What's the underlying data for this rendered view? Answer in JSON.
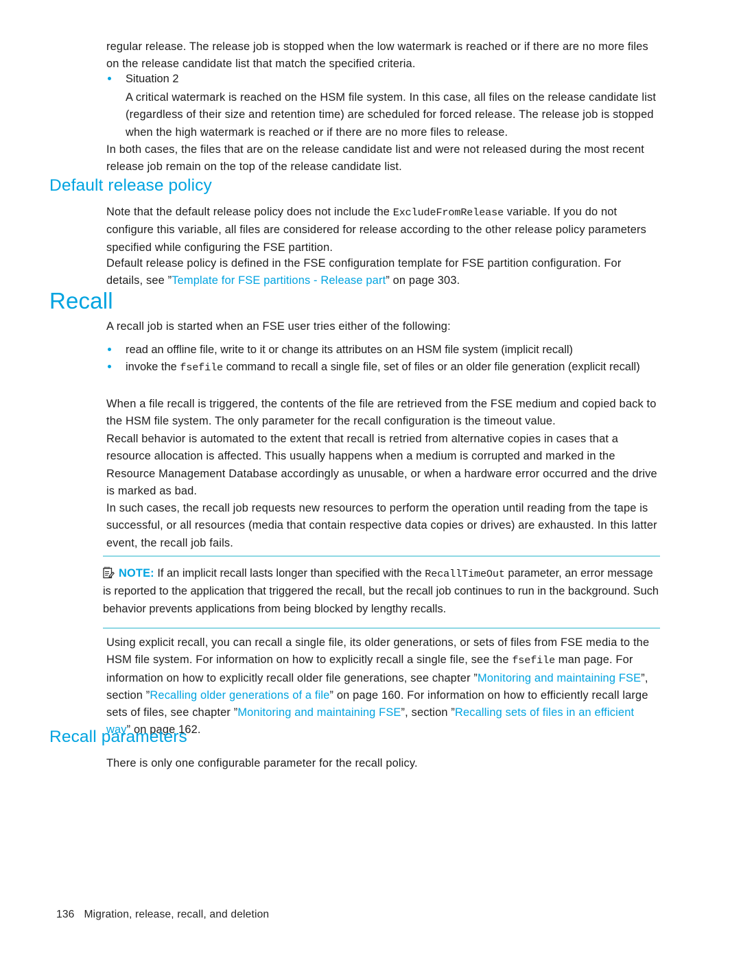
{
  "colors": {
    "accent": "#00a3e0",
    "note_rule": "#8ed8e4",
    "body_text": "#1c1c1c"
  },
  "body": {
    "para_intro": "regular release. The release job is stopped when the low watermark is reached or if there are no more files on the release candidate list that match the specified criteria.",
    "bullet_situation2": "Situation 2",
    "para_situation2": "A critical watermark is reached on the HSM file system. In this case, all files on the release candidate list (regardless of their size and retention time) are scheduled for forced release. The release job is stopped when the high watermark is reached or if there are no more files to release.",
    "para_both_cases": "In both cases, the files that are on the release candidate list and were not released during the most recent release job remain on the top of the release candidate list."
  },
  "section_default_release_policy": {
    "heading": "Default release policy",
    "para_note_variable_1": "Note that the default release policy does not include the ",
    "para_note_variable_code": "ExcludeFromRelease",
    "para_note_variable_2": " variable. If you do not configure this variable, all files are considered for release according to the other release policy parameters specified while configuring the FSE partition.",
    "para_template_1": "Default release policy is defined in the FSE configuration template for FSE partition configuration. For details, see ”",
    "para_template_link": "Template for FSE partitions - Release part",
    "para_template_2": "” on page 303."
  },
  "section_recall": {
    "heading": "Recall",
    "para_intro": "A recall job is started when an FSE user tries either of the following:",
    "bullet_implicit": "read an offline file, write to it or change its attributes on an HSM file system (implicit recall)",
    "bullet_explicit_1": "invoke the ",
    "bullet_explicit_code": "fsefile",
    "bullet_explicit_2": " command to recall a single file, set of files or an older file generation (explicit recall)",
    "para_triggered": "When a file recall is triggered, the contents of the file are retrieved from the FSE medium and copied back to the HSM file system. The only parameter for the recall configuration is the timeout value.",
    "para_behavior": "Recall behavior is automated to the extent that recall is retried from alternative copies in cases that a resource allocation is affected. This usually happens when a medium is corrupted and marked in the Resource Management Database accordingly as unusable, or when a hardware error occurred and the drive is marked as bad.",
    "para_such_cases": "In such cases, the recall job requests new resources to perform the operation until reading from the tape is successful, or all resources (media that contain respective data copies or drives) are exhausted. In this latter event, the recall job fails."
  },
  "note": {
    "icon": "note-pad-pencil-icon",
    "label": "NOTE:",
    "text_1": " If an implicit recall lasts longer than specified with the ",
    "code": "RecallTimeOut",
    "text_2": " parameter, an error message is reported to the application that triggered the recall, but the recall job continues to run in the background. Such behavior prevents applications from being blocked by lengthy recalls."
  },
  "section_explicit_recall": {
    "text_1": "Using explicit recall, you can recall a single file, its older generations, or sets of files from FSE media to the HSM file system. For information on how to explicitly recall a single file, see the ",
    "code_1": "fsefile",
    "text_2": " man page. For information on how to explicitly recall older file generations, see chapter ”",
    "link_1": "Monitoring and maintaining FSE",
    "text_3": "”, section ”",
    "link_2": "Recalling older generations of a file",
    "text_4": "” on page 160. For information on how to efficiently recall large sets of files, see chapter ”",
    "link_3": "Monitoring and maintaining FSE",
    "text_5": "”, section ”",
    "link_4": "Recalling sets of files in an efficient way",
    "text_6": "” on page 162."
  },
  "section_recall_parameters": {
    "heading": "Recall parameters",
    "para": "There is only one configurable parameter for the recall policy."
  },
  "footer": {
    "page_number": "136",
    "chapter_title": "Migration, release, recall, and deletion"
  }
}
